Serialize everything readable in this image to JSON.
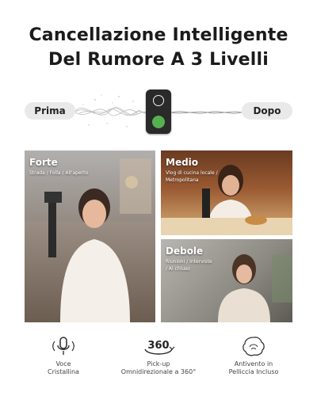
{
  "header": {
    "line1": "Cancellazione Intelligente",
    "line2": "Del Rumore A 3 Livelli"
  },
  "comparison": {
    "before_label": "Prima",
    "after_label": "Dopo"
  },
  "levels": [
    {
      "title": "Forte",
      "subtitle": "Strada / Folla / All'aperto"
    },
    {
      "title": "Medio",
      "subtitle": "Vlog di cucina locale /\nMetropolitana"
    },
    {
      "title": "Debole",
      "subtitle": "Riunioni / Interviste\n/ Al chiuso"
    }
  ],
  "features": [
    {
      "icon": "microphone-icon",
      "label": "Voce\nCristallina"
    },
    {
      "icon": "360-icon",
      "icon_text": "360",
      "label": "Pick-up\nOmnidirezionale a 360°"
    },
    {
      "icon": "windscreen-icon",
      "label": "Antivento in\nPelliccia Incluso"
    }
  ],
  "colors": {
    "led": "#56b04f",
    "device": "#2a2a2a",
    "pill": "#e9e9e9"
  }
}
